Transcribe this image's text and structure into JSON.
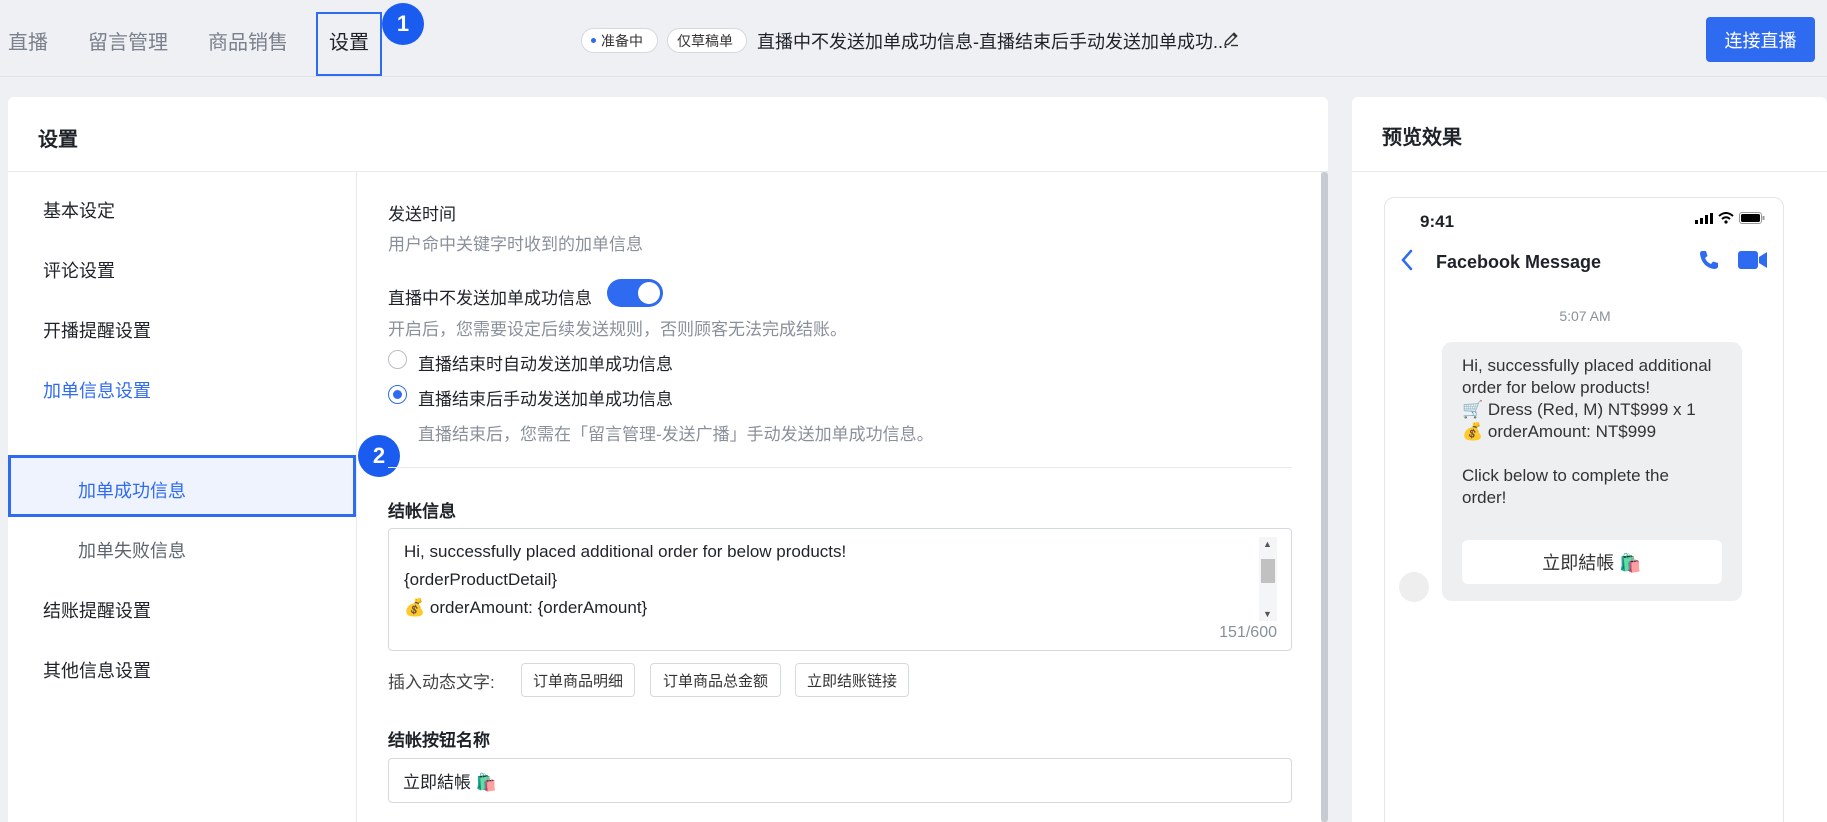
{
  "nav": {
    "tabs": [
      {
        "label": "直播"
      },
      {
        "label": "留言管理"
      },
      {
        "label": "商品销售"
      },
      {
        "label": "设置"
      }
    ],
    "status_pill": "准备中",
    "draft_pill": "仅草稿单",
    "live_title": "直播中不发送加单成功信息-直播结束后手动发送加单成功...",
    "connect_button": "连接直播",
    "markers": [
      "1",
      "2"
    ]
  },
  "settings": {
    "title": "设置",
    "sidebar": [
      {
        "label": "基本设定"
      },
      {
        "label": "评论设置"
      },
      {
        "label": "开播提醒设置"
      },
      {
        "label": "加单信息设置"
      },
      {
        "label": "加单成功信息"
      },
      {
        "label": "加单失败信息"
      },
      {
        "label": "结账提醒设置"
      },
      {
        "label": "其他信息设置"
      }
    ],
    "send_time_label": "发送时间",
    "send_time_hint": "用户命中关键字时收到的加单信息",
    "toggle_label": "直播中不发送加单成功信息",
    "toggle_on": true,
    "toggle_hint": "开启后，您需要设定后续发送规则，否则顾客无法完成结账。",
    "radio_auto": "直播结束时自动发送加单成功信息",
    "radio_manual": "直播结束后手动发送加单成功信息",
    "radio_manual_hint": "直播结束后，您需在「留言管理-发送广播」手动发送加单成功信息。",
    "checkout_label": "结帐信息",
    "checkout_lines": [
      "Hi, successfully placed additional order for below products!",
      " {orderProductDetail}",
      "💰 orderAmount: {orderAmount}"
    ],
    "char_count": "151/600",
    "insert_label": "插入动态文字:",
    "insert_chips": [
      "订单商品明细",
      "订单商品总金额",
      "立即结账链接"
    ],
    "button_name_label": "结帐按钮名称",
    "button_name_value": "立即結帳 🛍️"
  },
  "preview": {
    "title": "预览效果",
    "status_time": "9:41",
    "chat_title": "Facebook Message",
    "msg_time": "5:07 AM",
    "bubble_lines": [
      "Hi, successfully placed additional",
      "order for below products!",
      "🛒 Dress (Red, M) NT$999 x 1",
      "💰 orderAmount: NT$999",
      "",
      " Click below to complete the",
      "order!"
    ],
    "bubble_button": "立即結帳 🛍️"
  },
  "colors": {
    "accent": "#2f6bf0",
    "marker": "#1a5cf0",
    "page_bg": "#eef0f4"
  }
}
